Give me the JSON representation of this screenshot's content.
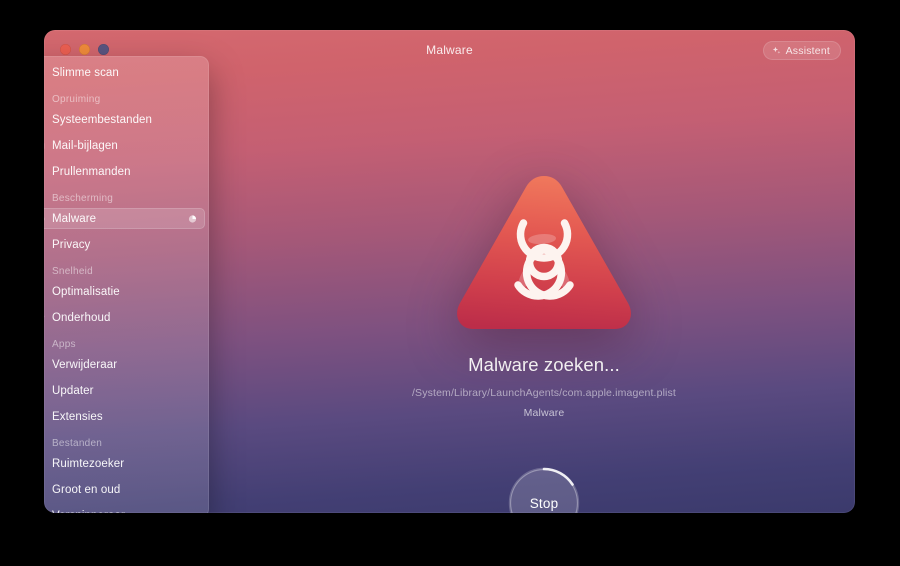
{
  "window": {
    "title": "Malware",
    "traffic_lights": [
      "close-button",
      "minimize-button",
      "zoom-button"
    ],
    "assistant_label": "Assistent"
  },
  "sidebar": {
    "top_items": [
      {
        "label": "Slimme scan",
        "icon": "smart-scan-icon",
        "key": "slimme-scan"
      }
    ],
    "sections": [
      {
        "label": "Opruiming",
        "items": [
          {
            "label": "Systeembestanden",
            "icon": "system-junk-icon",
            "key": "systeembestanden"
          },
          {
            "label": "Mail-bijlagen",
            "icon": "mail-icon",
            "key": "mail-bijlagen"
          },
          {
            "label": "Prullenmanden",
            "icon": "trash-icon",
            "key": "prullenmanden"
          }
        ]
      },
      {
        "label": "Bescherming",
        "items": [
          {
            "label": "Malware",
            "icon": "biohazard-icon",
            "key": "malware",
            "active": true,
            "busy": true
          },
          {
            "label": "Privacy",
            "icon": "hand-privacy-icon",
            "key": "privacy"
          }
        ]
      },
      {
        "label": "Snelheid",
        "items": [
          {
            "label": "Optimalisatie",
            "icon": "sliders-icon",
            "key": "optimalisatie"
          },
          {
            "label": "Onderhoud",
            "icon": "wrench-icon",
            "key": "onderhoud"
          }
        ]
      },
      {
        "label": "Apps",
        "items": [
          {
            "label": "Verwijderaar",
            "icon": "uninstaller-icon",
            "key": "verwijderaar"
          },
          {
            "label": "Updater",
            "icon": "updater-icon",
            "key": "updater"
          },
          {
            "label": "Extensies",
            "icon": "extensions-icon",
            "key": "extensies"
          }
        ]
      },
      {
        "label": "Bestanden",
        "items": [
          {
            "label": "Ruimtezoeker",
            "icon": "space-lens-icon",
            "key": "ruimtezoeker"
          },
          {
            "label": "Groot en oud",
            "icon": "large-old-files-icon",
            "key": "groot-en-oud"
          },
          {
            "label": "Versnipperaar",
            "icon": "shredder-icon",
            "key": "versnipperaar"
          }
        ]
      }
    ]
  },
  "main": {
    "hazard_icon": "biohazard-triangle-icon",
    "scan_title": "Malware zoeken...",
    "scan_path": "/System/Library/LaunchAgents/com.apple.imagent.plist",
    "scan_category": "Malware",
    "stop_label": "Stop",
    "progress_percent": 11
  },
  "colors": {
    "gradient_top": "#d4696f",
    "gradient_bottom": "#3b3a6c",
    "hazard_top": "#ef7059",
    "hazard_bottom": "#c8324a",
    "close_button": "#ec5f52",
    "minimize_button": "#f08b3b",
    "zoom_button": "#5a5580"
  }
}
